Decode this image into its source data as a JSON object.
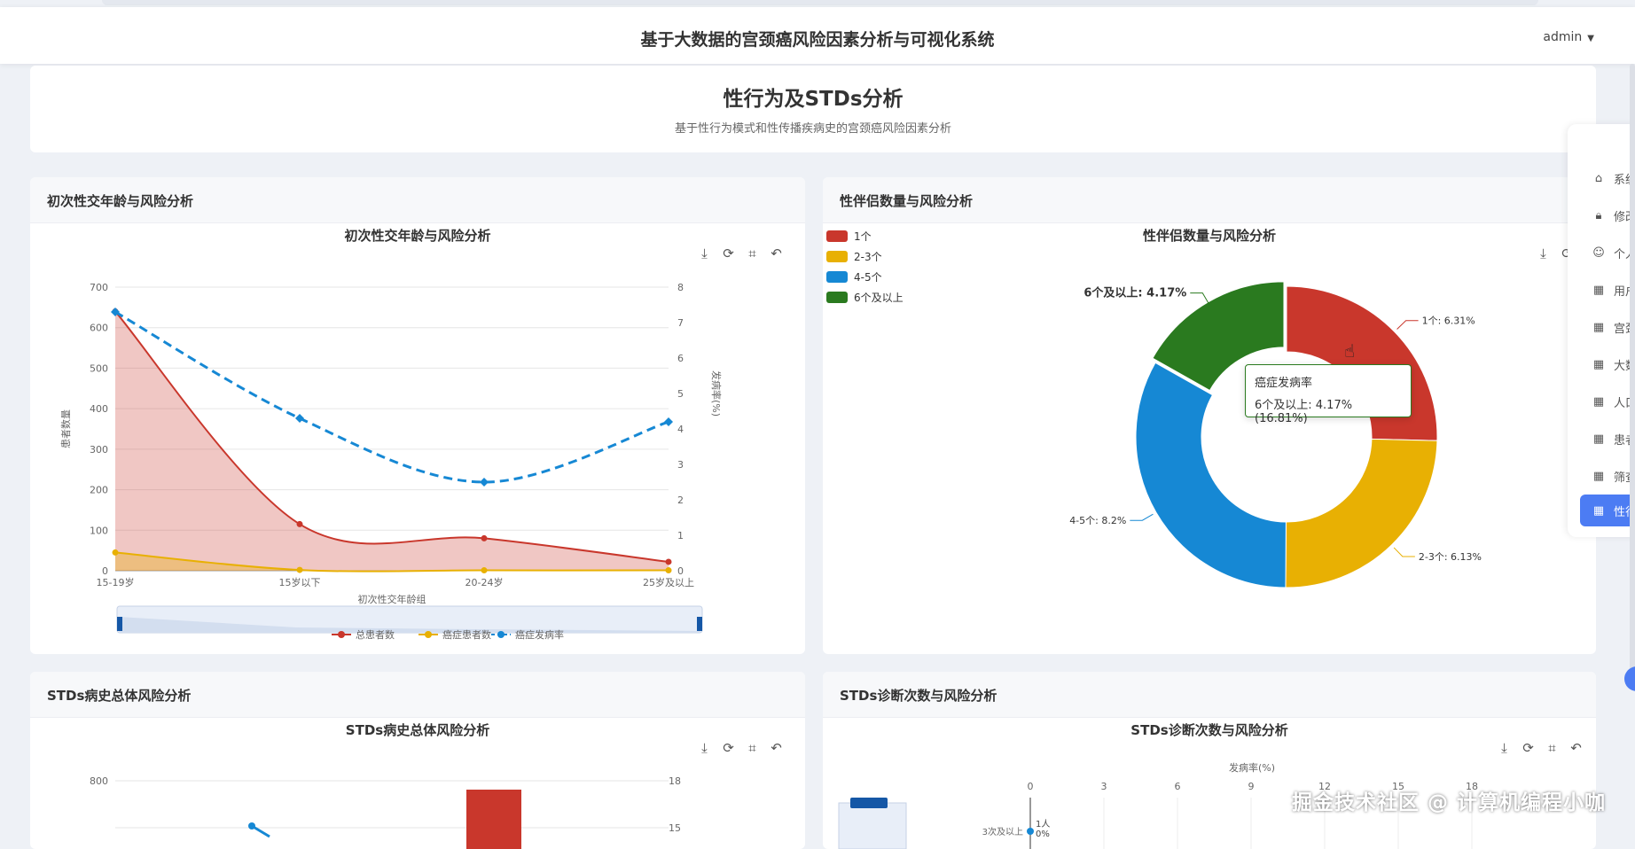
{
  "app": {
    "title": "基于大数据的宫颈癌风险因素分析与可视化系统",
    "user": "admin"
  },
  "page": {
    "title": "性行为及STDs分析",
    "subtitle": "基于性行为模式和性传播疾病史的宫颈癌风险因素分析"
  },
  "panels": {
    "p1": {
      "header": "初次性交年龄与风险分析",
      "chart_title": "初次性交年龄与风险分析"
    },
    "p2": {
      "header": "性伴侣数量与风险分析",
      "chart_title": "性伴侣数量与风险分析"
    },
    "p3": {
      "header": "STDs病史总体风险分析",
      "chart_title": "STDs病史总体风险分析"
    },
    "p4": {
      "header": "STDs诊断次数与风险分析",
      "chart_title": "STDs诊断次数与风险分析"
    }
  },
  "tooltip": {
    "title": "癌症发病率",
    "value": "6个及以上: 4.17% (16.81%)"
  },
  "side_menu": {
    "items": [
      "系统",
      "修改",
      "个人",
      "用户",
      "宫颈",
      "大数",
      "人口",
      "患者",
      "筛查",
      "性行"
    ]
  },
  "watermark": "掘金技术社区 @ 计算机编程小咖",
  "icons": {
    "download": "download-icon",
    "refresh": "refresh-icon",
    "crop": "crop-icon",
    "restore": "restore-icon"
  },
  "colors": {
    "red": "#c9372c",
    "yellow": "#e8b003",
    "blue": "#1688d4",
    "green": "#2a7a1f",
    "accent": "#4c7cf3"
  },
  "chart_data": [
    {
      "type": "line",
      "title": "初次性交年龄与风险分析",
      "xlabel": "初次性交年龄组",
      "ylabel": "患者数量",
      "y2label": "发病率(%)",
      "categories": [
        "15-19岁",
        "15岁以下",
        "20-24岁",
        "25岁及以上"
      ],
      "ylim": [
        0,
        700
      ],
      "yticks": [
        "0",
        "100",
        "200",
        "300",
        "400",
        "500",
        "600",
        "700"
      ],
      "y2lim": [
        0,
        8
      ],
      "y2ticks": [
        "0",
        "1",
        "2",
        "3",
        "4",
        "5",
        "6",
        "7",
        "8"
      ],
      "series": [
        {
          "name": "总患者数",
          "axis": "left",
          "values": [
            640,
            115,
            80,
            22
          ]
        },
        {
          "name": "癌症患者数",
          "axis": "left",
          "values": [
            45,
            2,
            1,
            1
          ]
        },
        {
          "name": "癌症发病率",
          "axis": "right",
          "values": [
            7.3,
            4.3,
            2.5,
            4.2
          ]
        }
      ]
    },
    {
      "type": "pie",
      "title": "性伴侣数量与风险分析",
      "legend": [
        "1个",
        "2-3个",
        "4-5个",
        "6个及以上"
      ],
      "slices": [
        {
          "name": "1个",
          "label": "1个: 6.31%",
          "share": 25.4
        },
        {
          "name": "2-3个",
          "label": "2-3个: 6.13%",
          "share": 24.7
        },
        {
          "name": "4-5个",
          "label": "4-5个: 8.2%",
          "share": 33.1
        },
        {
          "name": "6个及以上",
          "label": "6个及以上: 4.17%",
          "share": 16.81
        }
      ]
    },
    {
      "type": "bar",
      "title": "STDs病史总体风险分析",
      "yticks": [
        "800"
      ],
      "y2ticks": [
        "18",
        "15"
      ],
      "values": [
        780
      ]
    },
    {
      "type": "bar",
      "title": "STDs诊断次数与风险分析",
      "xlabel": "发病率(%)",
      "xticks": [
        "0",
        "3",
        "6",
        "9",
        "12",
        "15",
        "18"
      ],
      "categories": [
        "3次及以上"
      ],
      "annotations": [
        "1人",
        "0%"
      ]
    }
  ]
}
